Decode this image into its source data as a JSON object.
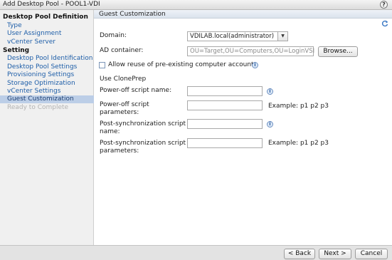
{
  "window": {
    "title": "Add Desktop Pool - POOL1-VDI",
    "help_label": "?"
  },
  "sidebar": {
    "section1": "Desktop Pool Definition",
    "items1": [
      {
        "label": "Type"
      },
      {
        "label": "User Assignment"
      },
      {
        "label": "vCenter Server"
      }
    ],
    "section2": "Setting",
    "items2": [
      {
        "label": "Desktop Pool Identification"
      },
      {
        "label": "Desktop Pool Settings"
      },
      {
        "label": "Provisioning Settings"
      },
      {
        "label": "Storage Optimization"
      },
      {
        "label": "vCenter Settings"
      },
      {
        "label": "Guest Customization",
        "state": "active"
      },
      {
        "label": "Ready to Complete",
        "state": "disabled"
      }
    ]
  },
  "main": {
    "header": "Guest Customization",
    "domain": {
      "label": "Domain:",
      "value": "VDILAB.local(administrator)"
    },
    "ad_container": {
      "label": "AD container:",
      "value": "OU=Target,OU=Computers,OU=LoginVSI",
      "browse_label": "Browse..."
    },
    "allow_reuse": {
      "label": "Allow reuse of pre-existing computer accounts",
      "checked": false
    },
    "clone_prep": "Use ClonePrep",
    "poweroff_name": {
      "label": "Power-off script name:",
      "value": ""
    },
    "poweroff_params": {
      "label_line1": "Power-off script",
      "label_line2": "parameters:",
      "value": "",
      "example": "Example: p1 p2 p3"
    },
    "postsync_name": {
      "label_line1": "Post-synchronization script",
      "label_line2": "name:",
      "value": ""
    },
    "postsync_params": {
      "label_line1": "Post-synchronization script",
      "label_line2": "parameters:",
      "value": "",
      "example": "Example: p1 p2 p3"
    }
  },
  "footer": {
    "back_label": "< Back",
    "next_label": "Next >",
    "cancel_label": "Cancel"
  },
  "colors": {
    "link": "#1e5ea8",
    "active_bg": "#bccee7",
    "sidebar_bg": "#f0f0f0",
    "footer_bg": "#e3e3e3"
  },
  "icons": [
    "help-icon",
    "refresh-icon",
    "info-icon",
    "dropdown-arrow-icon"
  ]
}
